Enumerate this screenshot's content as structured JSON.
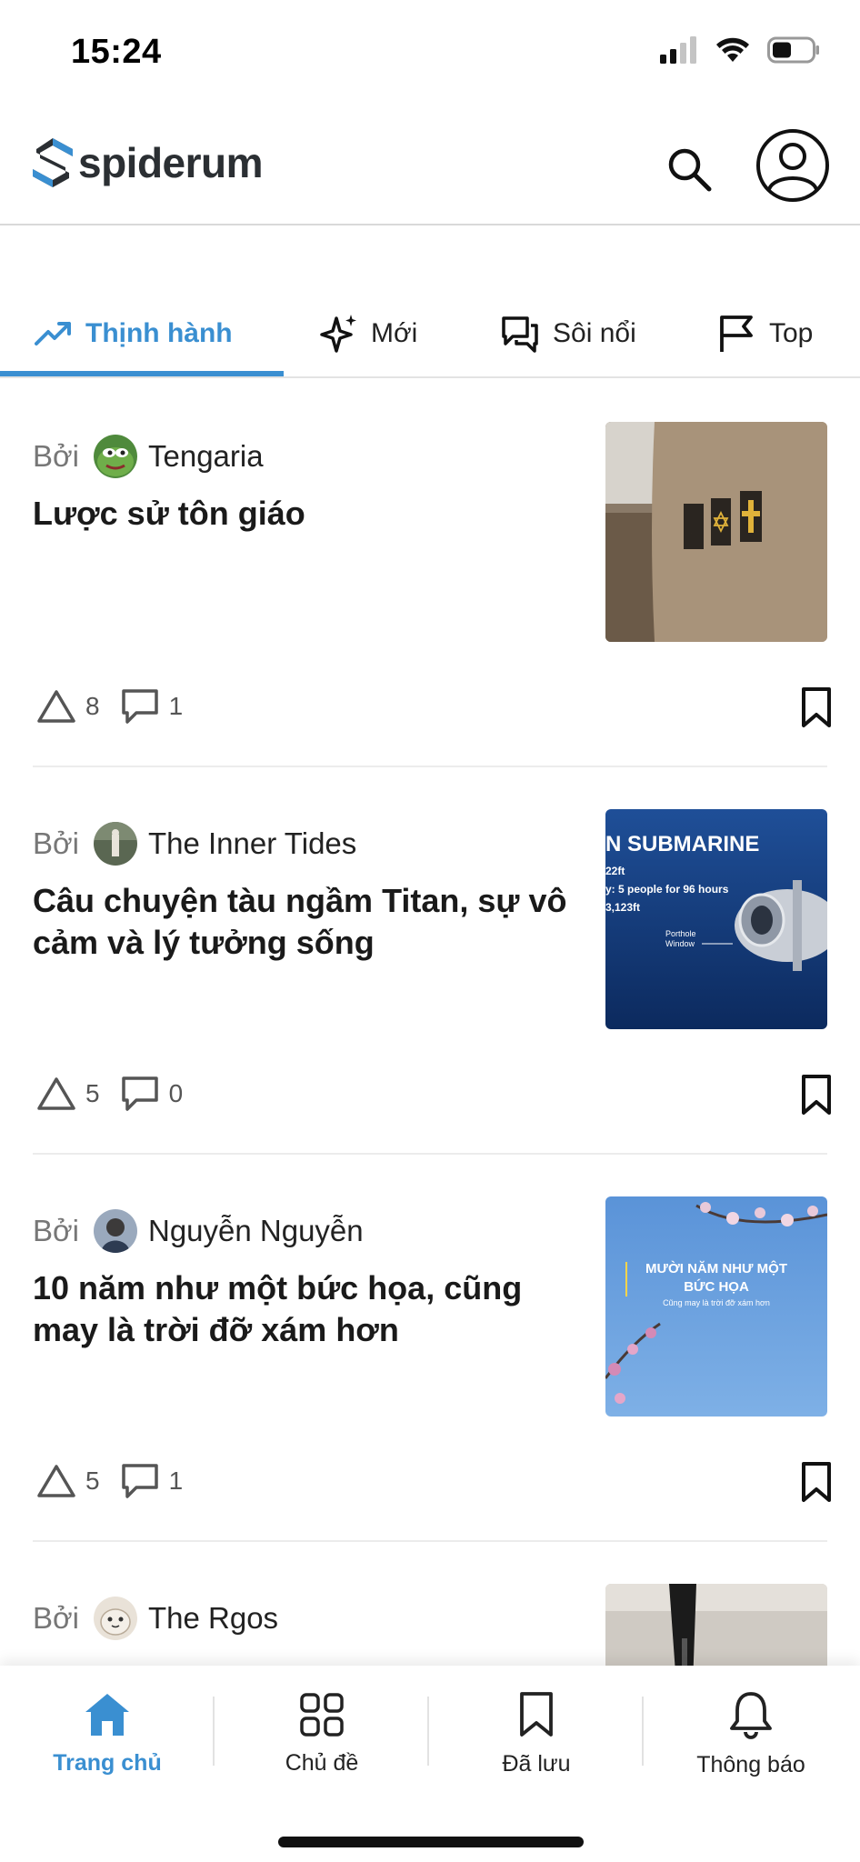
{
  "status_bar": {
    "time": "15:24"
  },
  "header": {
    "brand_name": "spiderum",
    "brand_color": "#2b2f33",
    "accent": "#3a8fd1",
    "search_icon": "search-icon",
    "profile_icon": "user-circle-icon"
  },
  "tabs": [
    {
      "label": "Thịnh hành",
      "icon": "trending-up-icon",
      "active": true
    },
    {
      "label": "Mới",
      "icon": "sparkle-icon",
      "active": false
    },
    {
      "label": "Sôi nổi",
      "icon": "chat-bubbles-icon",
      "active": false
    },
    {
      "label": "Top",
      "icon": "flag-icon",
      "active": false
    }
  ],
  "posts": [
    {
      "by_label": "Bởi",
      "author": "Tengaria",
      "title": "Lược sử tôn giáo",
      "upvotes": "8",
      "comments": "1"
    },
    {
      "by_label": "Bởi",
      "author": "The Inner Tides",
      "title": "Câu chuyện tàu ngầm Titan, sự vô cảm và lý tưởng sống",
      "upvotes": "5",
      "comments": "0",
      "thumb_text": {
        "heading": "N SUBMARINE",
        "line1": "22ft",
        "line2": "y: 5 people for 96 hours",
        "line3": "3,123ft",
        "porthole": "Porthole",
        "window": "Window"
      }
    },
    {
      "by_label": "Bởi",
      "author": "Nguyễn Nguyễn",
      "title": "10 năm như một bức họa, cũng may là trời đỡ xám hơn",
      "upvotes": "5",
      "comments": "1",
      "thumb_text": {
        "line1": "MƯỜI NĂM NHƯ MỘT",
        "line2": "BỨC HỌA",
        "line3": "Cũng may là trời đỡ xám hơn"
      }
    },
    {
      "by_label": "Bởi",
      "author": "The Rgos"
    }
  ],
  "bottom_nav": [
    {
      "label": "Trang chủ",
      "icon": "home-icon",
      "active": true
    },
    {
      "label": "Chủ đề",
      "icon": "grid-icon",
      "active": false
    },
    {
      "label": "Đã lưu",
      "icon": "bookmark-icon",
      "active": false
    },
    {
      "label": "Thông báo",
      "icon": "bell-icon",
      "active": false
    }
  ]
}
